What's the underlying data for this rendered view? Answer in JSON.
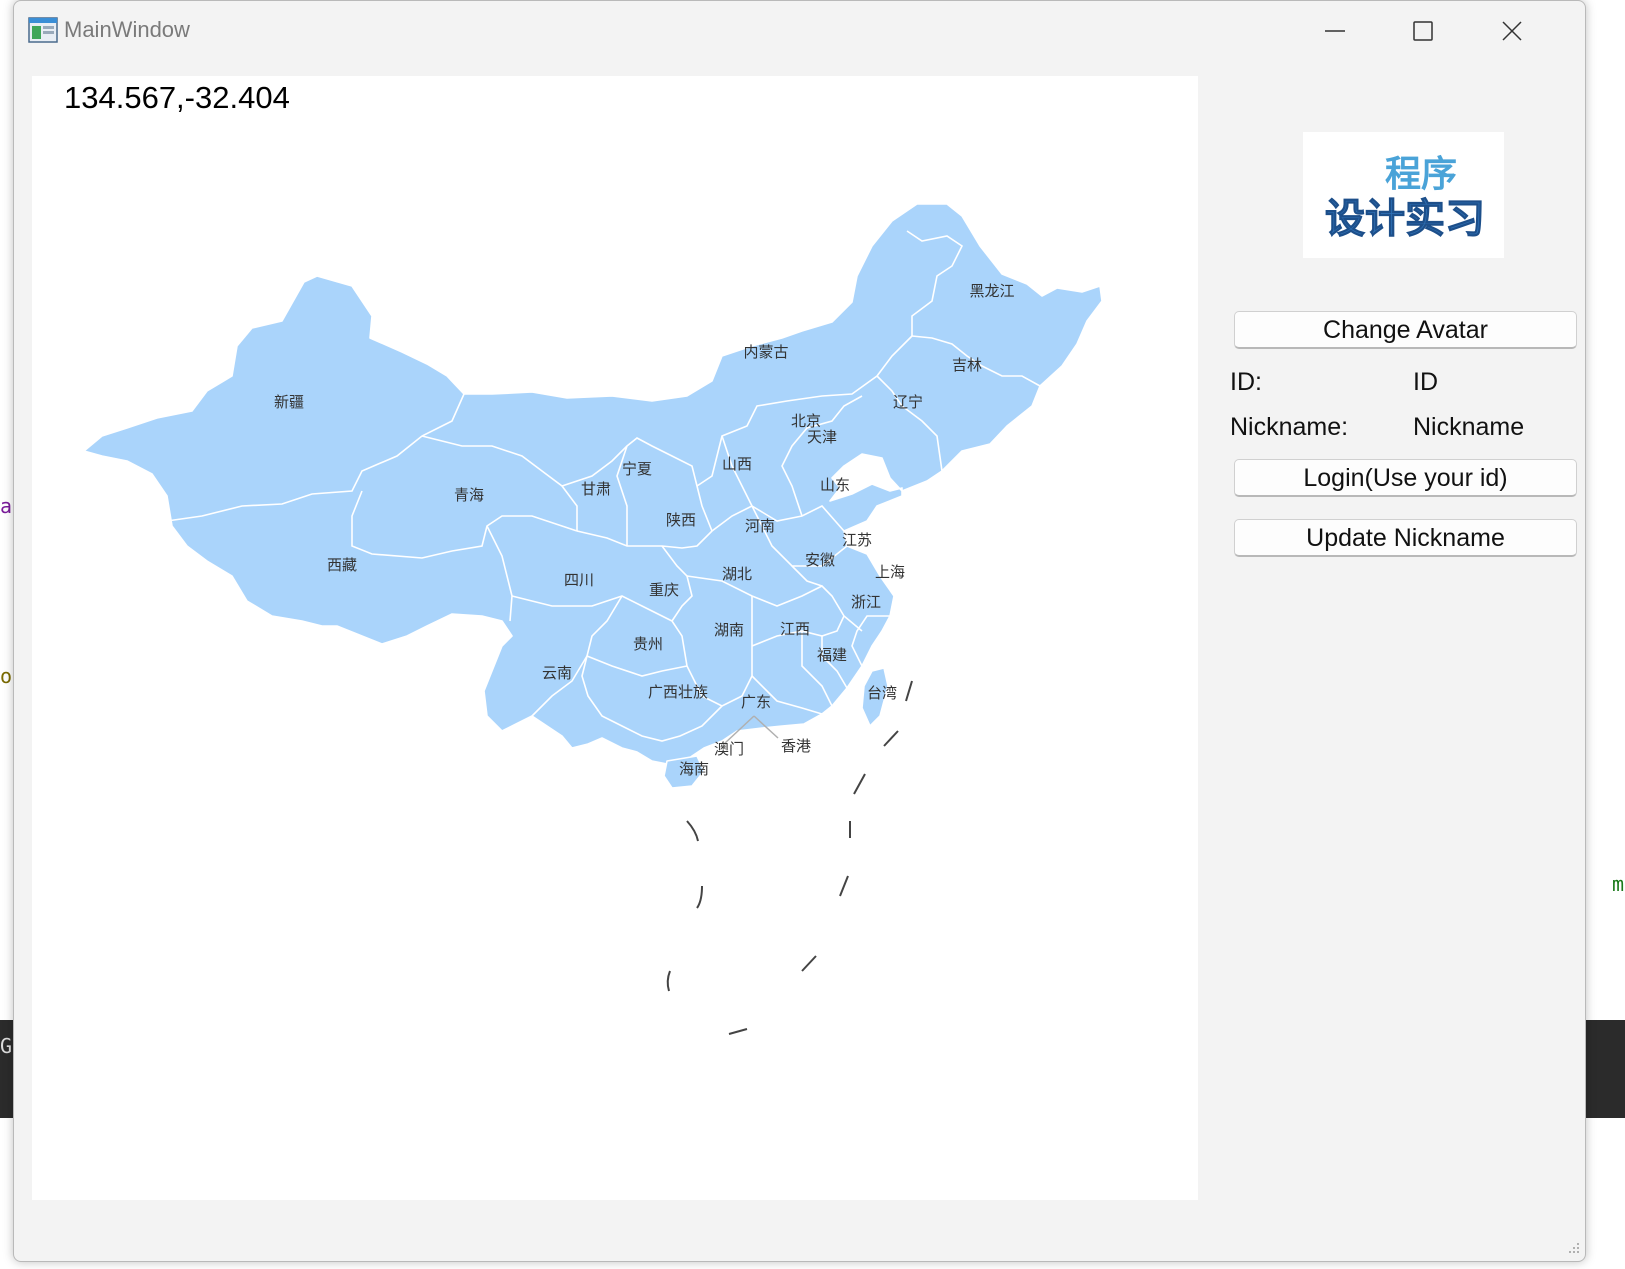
{
  "window": {
    "title": "MainWindow"
  },
  "map": {
    "coordinate_readout": "134.567,-32.404",
    "fill_color": "#aad4fb",
    "province_labels": {
      "heilongjiang": "黑龙江",
      "jilin": "吉林",
      "liaoning": "辽宁",
      "neimenggu": "内蒙古",
      "xinjiang": "新疆",
      "beijing": "北京",
      "tianjin": "天津",
      "shanxi": "山西",
      "shandong": "山东",
      "ningxia": "宁夏",
      "qinghai": "青海",
      "gansu": "甘肃",
      "shaanxi": "陕西",
      "henan": "河南",
      "jiangsu": "江苏",
      "xizang": "西藏",
      "anhui": "安徽",
      "shanghai": "上海",
      "sichuan": "四川",
      "hubei": "湖北",
      "chongqing": "重庆",
      "zhejiang": "浙江",
      "guizhou": "贵州",
      "hunan": "湖南",
      "jiangxi": "江西",
      "fujian": "福建",
      "yunnan": "云南",
      "taiwan": "台湾",
      "guangxi": "广西壮族",
      "guangdong": "广东",
      "macau": "澳门",
      "hongkong": "香港",
      "hainan": "海南"
    }
  },
  "sidebar": {
    "avatar_text_top": "程序",
    "avatar_text_bottom": "设计实习",
    "change_avatar_label": "Change Avatar",
    "id_label": "ID:",
    "id_value": "ID",
    "nickname_label": "Nickname:",
    "nickname_value": "Nickname",
    "login_label": "Login(Use your id)",
    "update_nickname_label": "Update Nickname"
  },
  "background": {
    "fragment_1": "a",
    "fragment_2": "o",
    "fragment_3": "m",
    "fragment_4": "G"
  }
}
